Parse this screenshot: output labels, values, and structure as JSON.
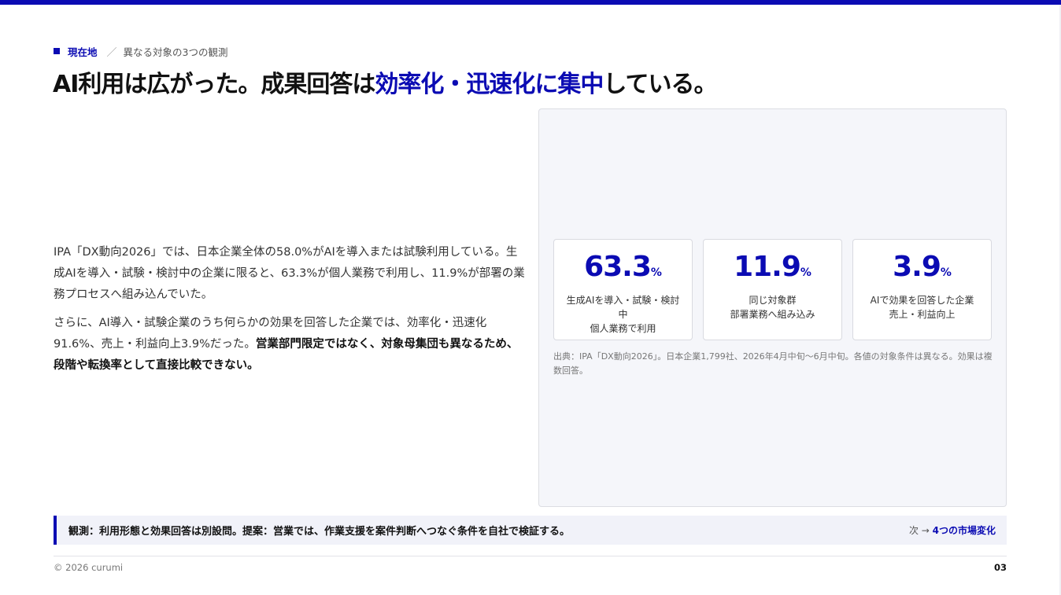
{
  "breadcrumb": {
    "current": "現在地",
    "separator": "／",
    "topic": "異なる対象の3つの観測"
  },
  "headline": {
    "part1": "AI利用は広がった。成果回答は",
    "accent": "効率化・迅速化に集中",
    "part2": "している。"
  },
  "body": {
    "para1": "IPA「DX動向2026」では、日本企業全体の58.0%がAIを導入または試験利用している。生成AIを導入・試験・検討中の企業に限ると、63.3%が個人業務で利用し、11.9%が部署の業務プロセスへ組み込んでいた。",
    "para2_plain": "さらに、AI導入・試験企業のうち何らかの効果を回答した企業では、効率化・迅速化91.6%、売上・利益向上3.9%だった。",
    "para2_bold": "営業部門限定ではなく、対象母集団も異なるため、段階や転換率として直接比較できない。"
  },
  "stats": [
    {
      "value": "63.3",
      "unit": "%",
      "label_line1": "生成AIを導入・試験・検討中",
      "label_line2": "個人業務で利用"
    },
    {
      "value": "11.9",
      "unit": "%",
      "label_line1": "同じ対象群",
      "label_line2": "部署業務へ組み込み"
    },
    {
      "value": "3.9",
      "unit": "%",
      "label_line1": "AIで効果を回答した企業",
      "label_line2": "売上・利益向上"
    }
  ],
  "source": "出典：IPA「DX動向2026」。日本企業1,799社、2026年4月中旬〜6月中旬。各値の対象条件は異なる。効果は複数回答。",
  "callout": {
    "text": "観測：利用形態と効果回答は別設問。提案：営業では、作業支援を案件判断へつなぐ条件を自社で検証する。",
    "next_prefix": "次 → ",
    "next_target": "4つの市場変化"
  },
  "footer": {
    "copyright": "© 2026 curumi",
    "page": "03"
  },
  "colors": {
    "accent": "#0b0bb3",
    "panel_bg": "#f5f6fa",
    "callout_bg": "#f1f2f9"
  }
}
